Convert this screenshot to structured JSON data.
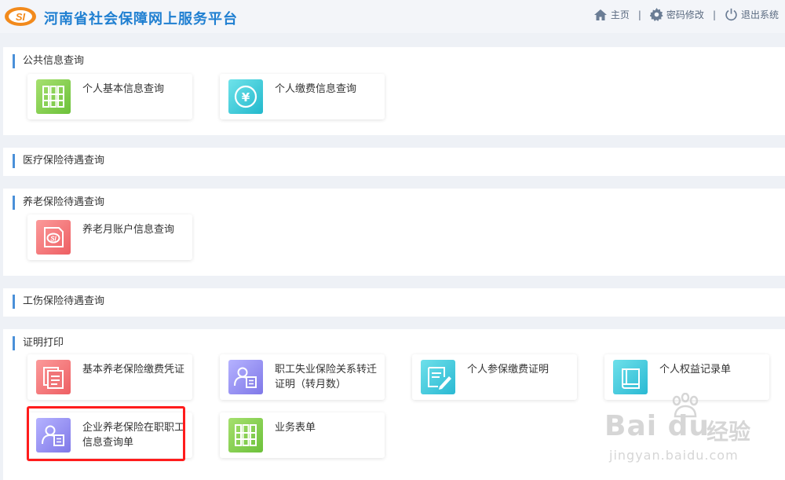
{
  "header": {
    "title": "河南省社会保障网上服务平台",
    "logo_text": "SI",
    "home": "主页",
    "change_password": "密码修改",
    "logout": "退出系统",
    "separator": "|"
  },
  "sections": [
    {
      "title": "公共信息查询",
      "cards": [
        "个人基本信息查询",
        "个人缴费信息查询"
      ]
    },
    {
      "title": "医疗保险待遇查询",
      "cards": []
    },
    {
      "title": "养老保险待遇查询",
      "cards": [
        "养老月账户信息查询"
      ]
    },
    {
      "title": "工伤保险待遇查询",
      "cards": []
    },
    {
      "title": "证明打印",
      "cards": [
        "基本养老保险缴费凭证",
        "职工失业保险关系转迁证明（转月数）",
        "个人参保缴费证明",
        "个人权益记录单",
        "企业养老保险在职职工信息查询单",
        "业务表单"
      ]
    }
  ],
  "watermark": {
    "brand": "Bai du",
    "cn": "经验",
    "url": "jingyan.baidu.com"
  },
  "colors": {
    "title_blue": "#1f7fd1",
    "section_bar": "#4a90d9",
    "highlight": "#ff1c1c"
  }
}
